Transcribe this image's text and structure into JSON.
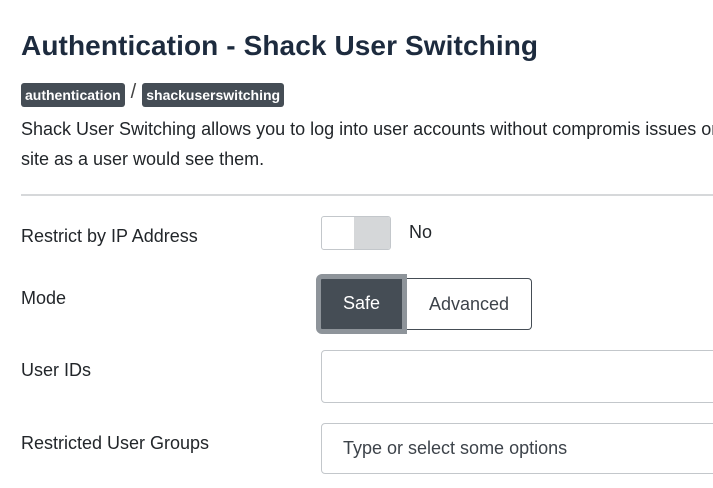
{
  "header": {
    "title": "Authentication - Shack User Switching"
  },
  "breadcrumb": {
    "items": [
      "authentication",
      "shackuserswitching"
    ],
    "separator": "/"
  },
  "description": "Shack User Switching allows you to log into user accounts without compromis issues on the site as a user would see them.",
  "fields": {
    "restrict_ip": {
      "label": "Restrict by IP Address",
      "value_text": "No"
    },
    "mode": {
      "label": "Mode",
      "options": [
        "Safe",
        "Advanced"
      ],
      "selected": "Safe"
    },
    "user_ids": {
      "label": "User IDs",
      "value": ""
    },
    "restricted_groups": {
      "label": "Restricted User Groups",
      "placeholder": "Type or select some options"
    }
  },
  "colors": {
    "title": "#1d2b3e",
    "badge_bg": "#454d55",
    "active_button_bg": "#454d55",
    "divider": "#d6d8da"
  }
}
